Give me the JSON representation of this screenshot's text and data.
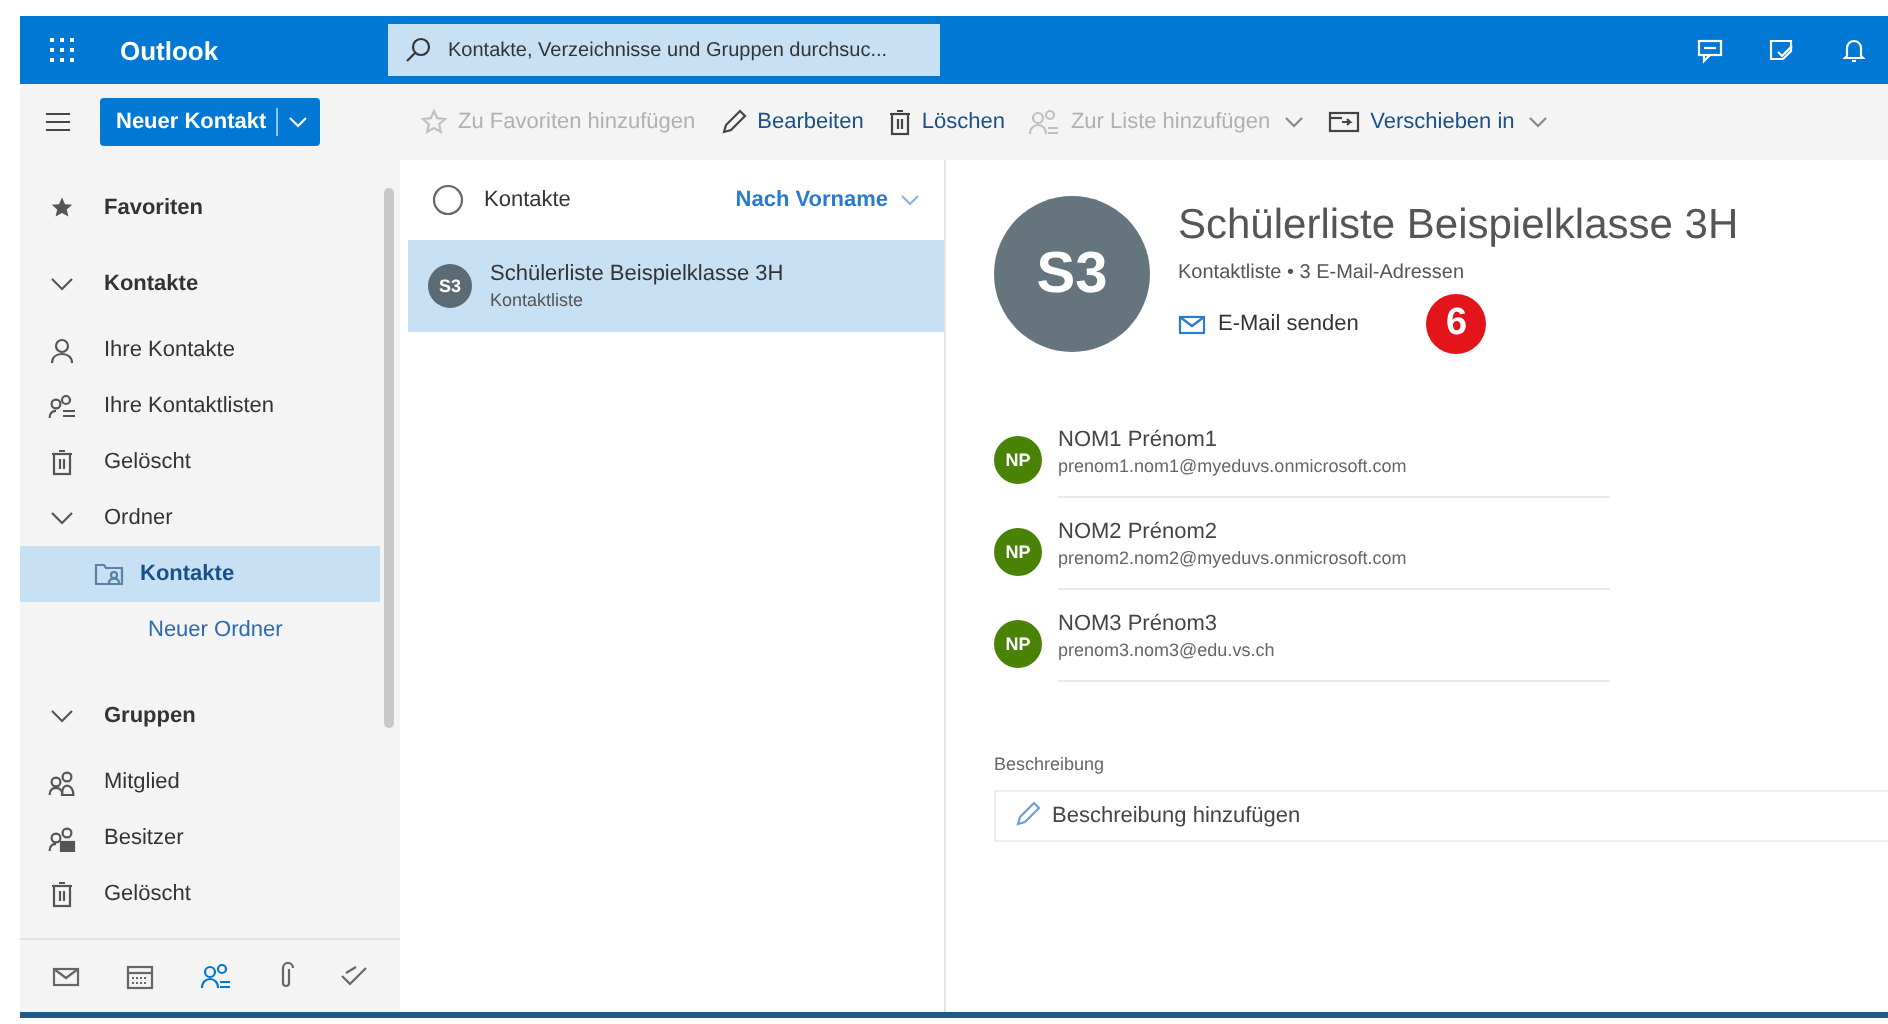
{
  "header": {
    "app_name": "Outlook",
    "search": {
      "placeholder": "Kontakte, Verzeichnisse und Gruppen durchsuc..."
    }
  },
  "toolbar": {
    "new_button": "Neuer Kontakt",
    "actions": [
      {
        "label": "Zu Favoriten hinzufügen",
        "disabled": true,
        "dropdown": false
      },
      {
        "label": "Bearbeiten",
        "disabled": false,
        "dropdown": false
      },
      {
        "label": "Löschen",
        "disabled": false,
        "dropdown": false
      },
      {
        "label": "Zur Liste hinzufügen",
        "disabled": true,
        "dropdown": true
      },
      {
        "label": "Verschieben in",
        "disabled": false,
        "dropdown": true
      }
    ]
  },
  "sidebar": {
    "items": [
      {
        "kind": "section",
        "label": "Favoriten"
      },
      {
        "kind": "group",
        "label": "Kontakte",
        "expanded": true
      },
      {
        "kind": "item",
        "label": "Ihre Kontakte",
        "selected": false
      },
      {
        "kind": "item",
        "label": "Ihre Kontaktlisten",
        "selected": false
      },
      {
        "kind": "item",
        "label": "Gelöscht",
        "selected": false
      },
      {
        "kind": "subgroup",
        "label": "Ordner",
        "expanded": true
      },
      {
        "kind": "folder",
        "label": "Kontakte",
        "selected": true
      },
      {
        "kind": "link",
        "label": "Neuer Ordner"
      },
      {
        "kind": "group",
        "label": "Gruppen",
        "expanded": true
      },
      {
        "kind": "item",
        "label": "Mitglied",
        "selected": false
      },
      {
        "kind": "item",
        "label": "Besitzer",
        "selected": false
      },
      {
        "kind": "item",
        "label": "Gelöscht",
        "selected": false
      }
    ],
    "nav": [
      {
        "selected": false
      },
      {
        "selected": false
      },
      {
        "selected": true
      },
      {
        "selected": false
      },
      {
        "selected": false
      }
    ]
  },
  "list": {
    "select_all": {
      "checked": false
    },
    "title": "Kontakte",
    "sort": "Nach Vorname",
    "rows": [
      {
        "initials": "S3",
        "name": "Schülerliste Beispielklasse 3H",
        "subtitle": "Kontaktliste",
        "selected": true
      }
    ]
  },
  "detail": {
    "initials": "S3",
    "name": "Schülerliste Beispielklasse 3H",
    "meta": "Kontaktliste • 3 E-Mail-Adressen",
    "send_mail": "E-Mail senden",
    "callout": "6",
    "members": [
      {
        "initials": "NP",
        "name": "NOM1 Prénom1",
        "email": "prenom1.nom1@myeduvs.onmicrosoft.com"
      },
      {
        "initials": "NP",
        "name": "NOM2 Prénom2",
        "email": "prenom2.nom2@myeduvs.onmicrosoft.com"
      },
      {
        "initials": "NP",
        "name": "NOM3 Prénom3",
        "email": "prenom3.nom3@edu.vs.ch"
      }
    ],
    "description_label": "Beschreibung",
    "description_placeholder": "Beschreibung hinzufügen"
  }
}
